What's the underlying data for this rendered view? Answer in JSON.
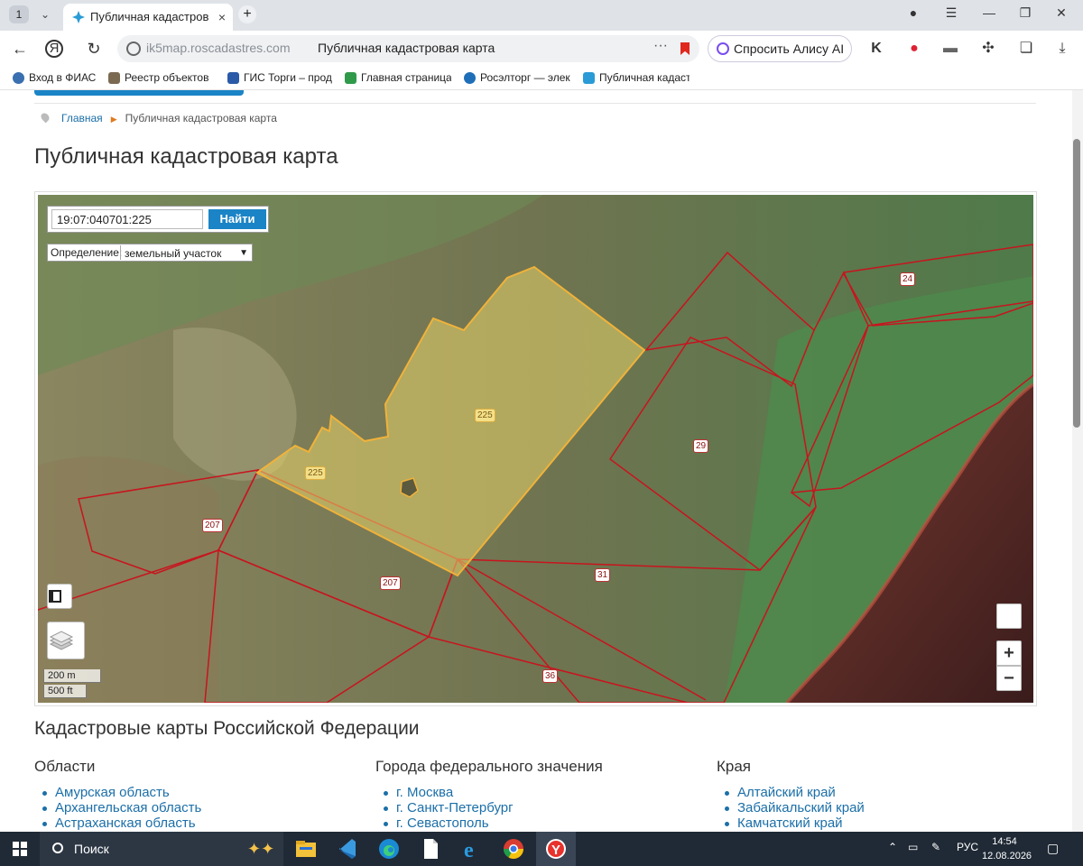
{
  "browser": {
    "tab_count": "1",
    "tab_title": "Публичная кадастров",
    "url": "ik5map.roscadastres.com",
    "page_title": "Публичная кадастровая карта",
    "alice_label": "Спросить Алису AI",
    "bookmarks": [
      "Вход в ФИАС",
      "Реестр объектов",
      "ГИС Торги – прод",
      "Главная страница",
      "Росэлторг — элек",
      "Публичная кадаст"
    ]
  },
  "page": {
    "breadcrumb_home": "Главная",
    "breadcrumb_current": "Публичная кадастровая карта",
    "title": "Публичная кадастровая карта"
  },
  "map": {
    "search_value": "19:07:040701:225",
    "search_button": "Найти",
    "definition_label": "Определение:",
    "definition_value": "земельный участок",
    "scale_m": "200 m",
    "scale_ft": "500 ft",
    "zoom_in": "+",
    "zoom_out": "−",
    "parcel_labels": [
      "225",
      "225",
      "24",
      "29",
      "207",
      "207",
      "31",
      "36"
    ],
    "colors": {
      "selected_fill": "#e8d36a",
      "selected_stroke": "#f0b23a",
      "boundary": "#c8141e"
    }
  },
  "regions": {
    "heading": "Кадастровые карты Российской Федерации",
    "columns": [
      {
        "title": "Области",
        "items": [
          "Амурская область",
          "Архангельская область",
          "Астраханская область"
        ]
      },
      {
        "title": "Города федерального значения",
        "items": [
          "г. Москва",
          "г. Санкт-Петербург",
          "г. Севастополь"
        ]
      },
      {
        "title": "Края",
        "items": [
          "Алтайский край",
          "Забайкальский край",
          "Камчатский край"
        ]
      }
    ]
  },
  "taskbar": {
    "search_label": "Поиск",
    "lang": "РУС",
    "time": "14:54",
    "date": "12.08.2026"
  }
}
